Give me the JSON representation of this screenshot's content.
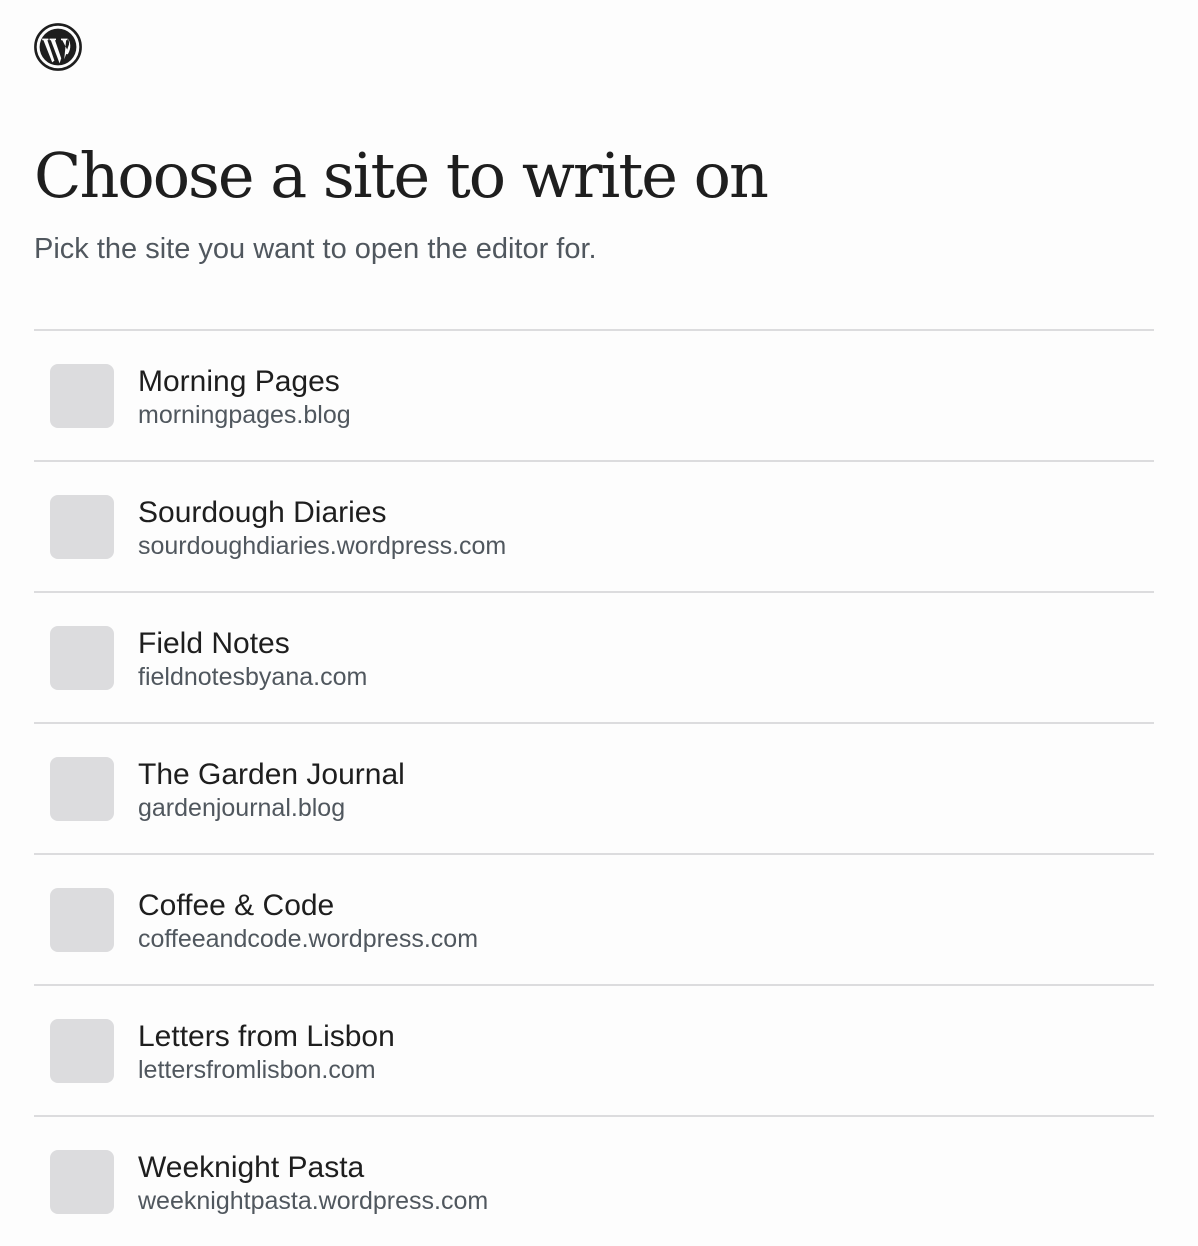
{
  "header": {
    "logo_icon": "wordpress-logo-icon"
  },
  "page": {
    "title": "Choose a site to write on",
    "subtitle": "Pick the site you want to open the editor for."
  },
  "sites": [
    {
      "name": "Morning Pages",
      "url": "morningpages.blog"
    },
    {
      "name": "Sourdough Diaries",
      "url": "sourdoughdiaries.wordpress.com"
    },
    {
      "name": "Field Notes",
      "url": "fieldnotesbyana.com"
    },
    {
      "name": "The Garden Journal",
      "url": "gardenjournal.blog"
    },
    {
      "name": "Coffee & Code",
      "url": "coffeeandcode.wordpress.com"
    },
    {
      "name": "Letters from Lisbon",
      "url": "lettersfromlisbon.com"
    },
    {
      "name": "Weeknight Pasta",
      "url": "weeknightpasta.wordpress.com"
    }
  ],
  "colors": {
    "text_primary": "#1e1e1e",
    "text_secondary": "#50575e",
    "divider": "#dcdcde",
    "site_icon_placeholder": "#dcdcde",
    "background": "#fdfdfd"
  }
}
